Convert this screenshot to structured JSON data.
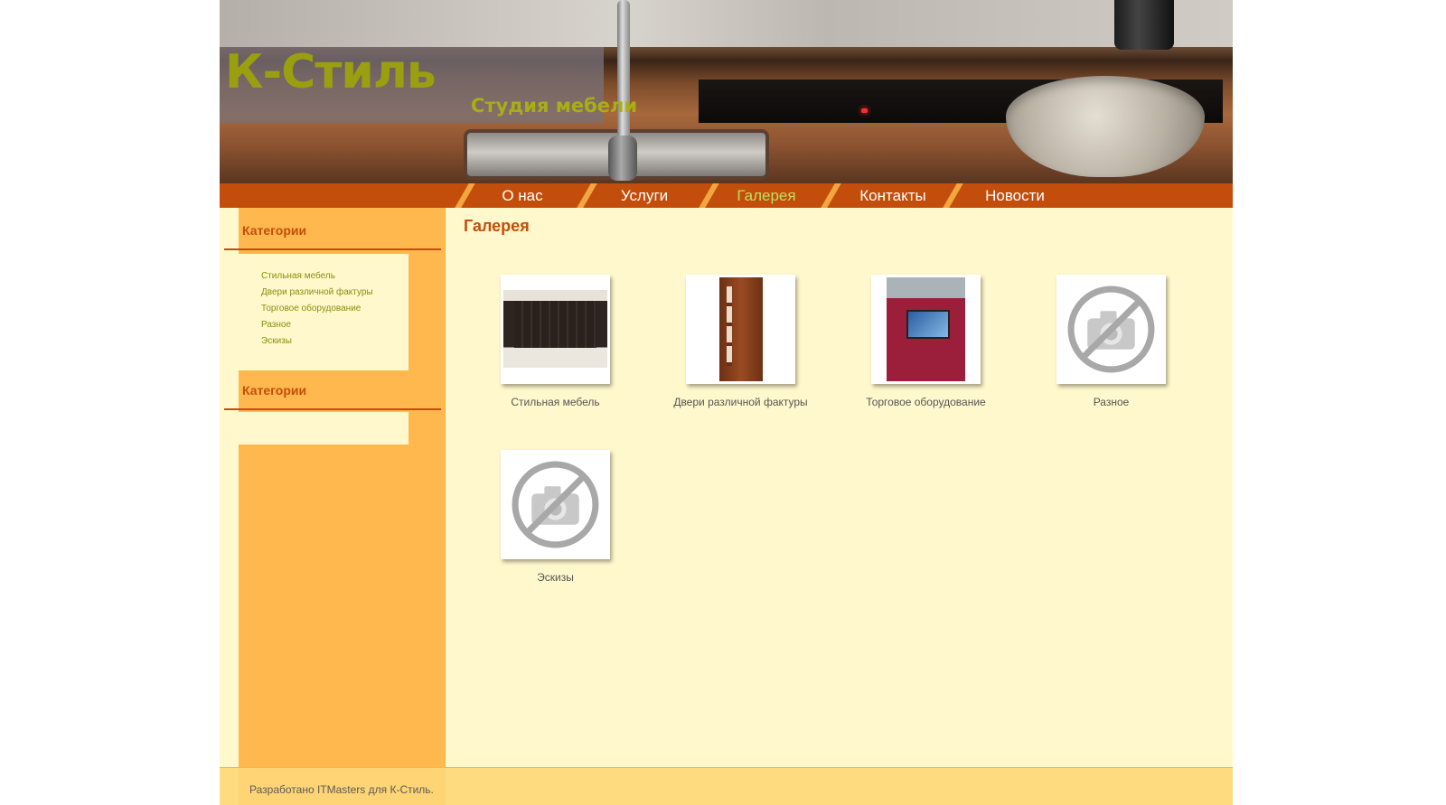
{
  "header": {
    "logo_title": "К-Стиль",
    "logo_subtitle": "Студия мебели"
  },
  "nav": {
    "items": [
      {
        "label": "О нас",
        "active": false
      },
      {
        "label": "Услуги",
        "active": false
      },
      {
        "label": "Галерея",
        "active": true
      },
      {
        "label": "Контакты",
        "active": false
      },
      {
        "label": "Новости",
        "active": false
      }
    ]
  },
  "sidebar": {
    "blocks": [
      {
        "title": "Категории",
        "links": [
          "Стильная мебель",
          "Двери различной фактуры",
          "Торговое оборудование",
          "Разное",
          "Эскизы"
        ]
      },
      {
        "title": "Категории",
        "links": []
      }
    ]
  },
  "main": {
    "title": "Галерея",
    "gallery": [
      {
        "caption": "Стильная мебель",
        "icon": "furniture-photo"
      },
      {
        "caption": "Двери различной фактуры",
        "icon": "door-photo"
      },
      {
        "caption": "Торговое оборудование",
        "icon": "retail-stand-photo"
      },
      {
        "caption": "Разное",
        "icon": "no-photo-icon"
      },
      {
        "caption": "Эскизы",
        "icon": "no-photo-icon"
      }
    ]
  },
  "footer": {
    "text": "Разработано ITMasters для К-Стиль."
  },
  "colors": {
    "accent": "#c34e0b",
    "sidebar": "#ffb84d",
    "content_bg": "#fff8cc",
    "logo": "#9a9f10",
    "nav_active": "#b7e063"
  }
}
